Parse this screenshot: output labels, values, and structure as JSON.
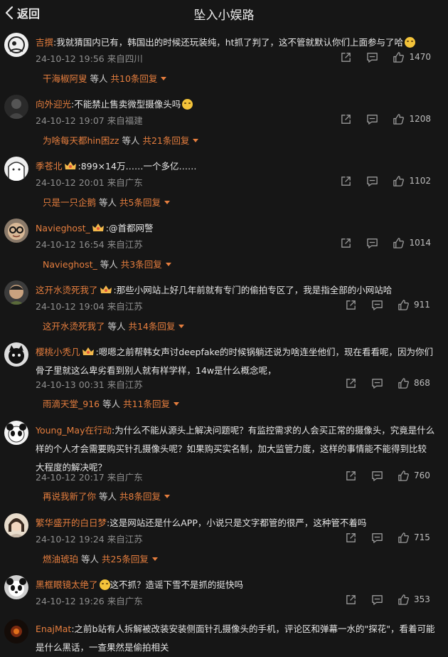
{
  "header": {
    "back_label": "返回",
    "title": "坠入小娱路"
  },
  "comments": [
    {
      "user": "吉撰",
      "text": ":我就猜国内已有，韩国出的时候还玩装纯，ht抓了判了，这不管就默认你们上面参与了哈",
      "emoji": "smile",
      "time": "24-10-12 19:56",
      "location": "来自四川",
      "likes": "1470",
      "reply_user": "干海椒阿叟",
      "reply_mid": "等人",
      "reply_count": "共10条回复"
    },
    {
      "user": "向外迎光",
      "text": ":不能禁止售卖微型摄像头吗",
      "emoji": "smile",
      "time": "24-10-12 19:07",
      "location": "来自福建",
      "likes": "1208",
      "reply_user": "为啥每天都hin困zz",
      "reply_mid": "等人",
      "reply_count": "共21条回复"
    },
    {
      "user": "季苍北",
      "text": ":899×14万……一个多亿……",
      "badge": true,
      "time": "24-10-12 20:01",
      "location": "来自广东",
      "likes": "1102",
      "reply_user": "只是一只企鹅",
      "reply_mid": "等人",
      "reply_count": "共5条回复"
    },
    {
      "user": "Navieghost_",
      "text": ":@首都网警",
      "badge": true,
      "time": "24-10-12 16:54",
      "location": "来自江苏",
      "likes": "1014",
      "reply_user": "Navieghost_",
      "reply_mid": "等人",
      "reply_count": "共3条回复"
    },
    {
      "user": "这开水烫死我了",
      "text": ":那些小网站上好几年前就有专门的偷拍专区了，我是指全部的小网站哈",
      "badge": true,
      "time": "24-10-12 19:04",
      "location": "来自江苏",
      "likes": "911",
      "reply_user": "这开水烫死我了",
      "reply_mid": "等人",
      "reply_count": "共14条回复"
    },
    {
      "user": "樱桃小秃几",
      "text": ":嗯嗯之前帮韩女声讨deepfake的时候锅躺还说为啥连坐他们，现在看看呢，因为你们骨子里就这么卑劣看到别人就有样学样，14w是什么概念呢，",
      "badge": true,
      "time": "24-10-13 00:31",
      "location": "来自江苏",
      "likes": "868",
      "reply_user": "雨滴天堂_916",
      "reply_mid": "等人",
      "reply_count": "共11条回复"
    },
    {
      "user": "Young_May在行动",
      "text": ":为什么不能从源头上解决问题呢？有监控需求的人会买正常的摄像头，究竟是什么样的个人才会需要购买针孔摄像头呢？如果购买实名制，加大监管力度，这样的事情能不能得到比较大程度的解决呢？",
      "time": "24-10-12 20:17",
      "location": "来自广东",
      "likes": "760",
      "reply_user": "再说我新了你",
      "reply_mid": "等人",
      "reply_count": "共8条回复"
    },
    {
      "user": "繁华盛开的白日梦",
      "text": ":这是网站还是什么APP，小说只是文字都管的很严，这种管不着吗",
      "time": "24-10-12 19:24",
      "location": "来自江苏",
      "likes": "715",
      "reply_user": "燃油琥珀",
      "reply_mid": "等人",
      "reply_count": "共25条回复"
    },
    {
      "user": "黑框眼镜太绝了",
      "text": "这不抓？造谣下雪不是抓的挺快吗",
      "emoji": "cry",
      "time": "24-10-12 19:26",
      "location": "来自广东",
      "likes": "353"
    },
    {
      "user": "EnajMat",
      "text": ":之前b站有人拆解被改装安装侧面针孔摄像头的手机，评论区和弹幕一水的\"探花\"，看着可能是什么黑话，一查果然是偷拍相关"
    }
  ]
}
